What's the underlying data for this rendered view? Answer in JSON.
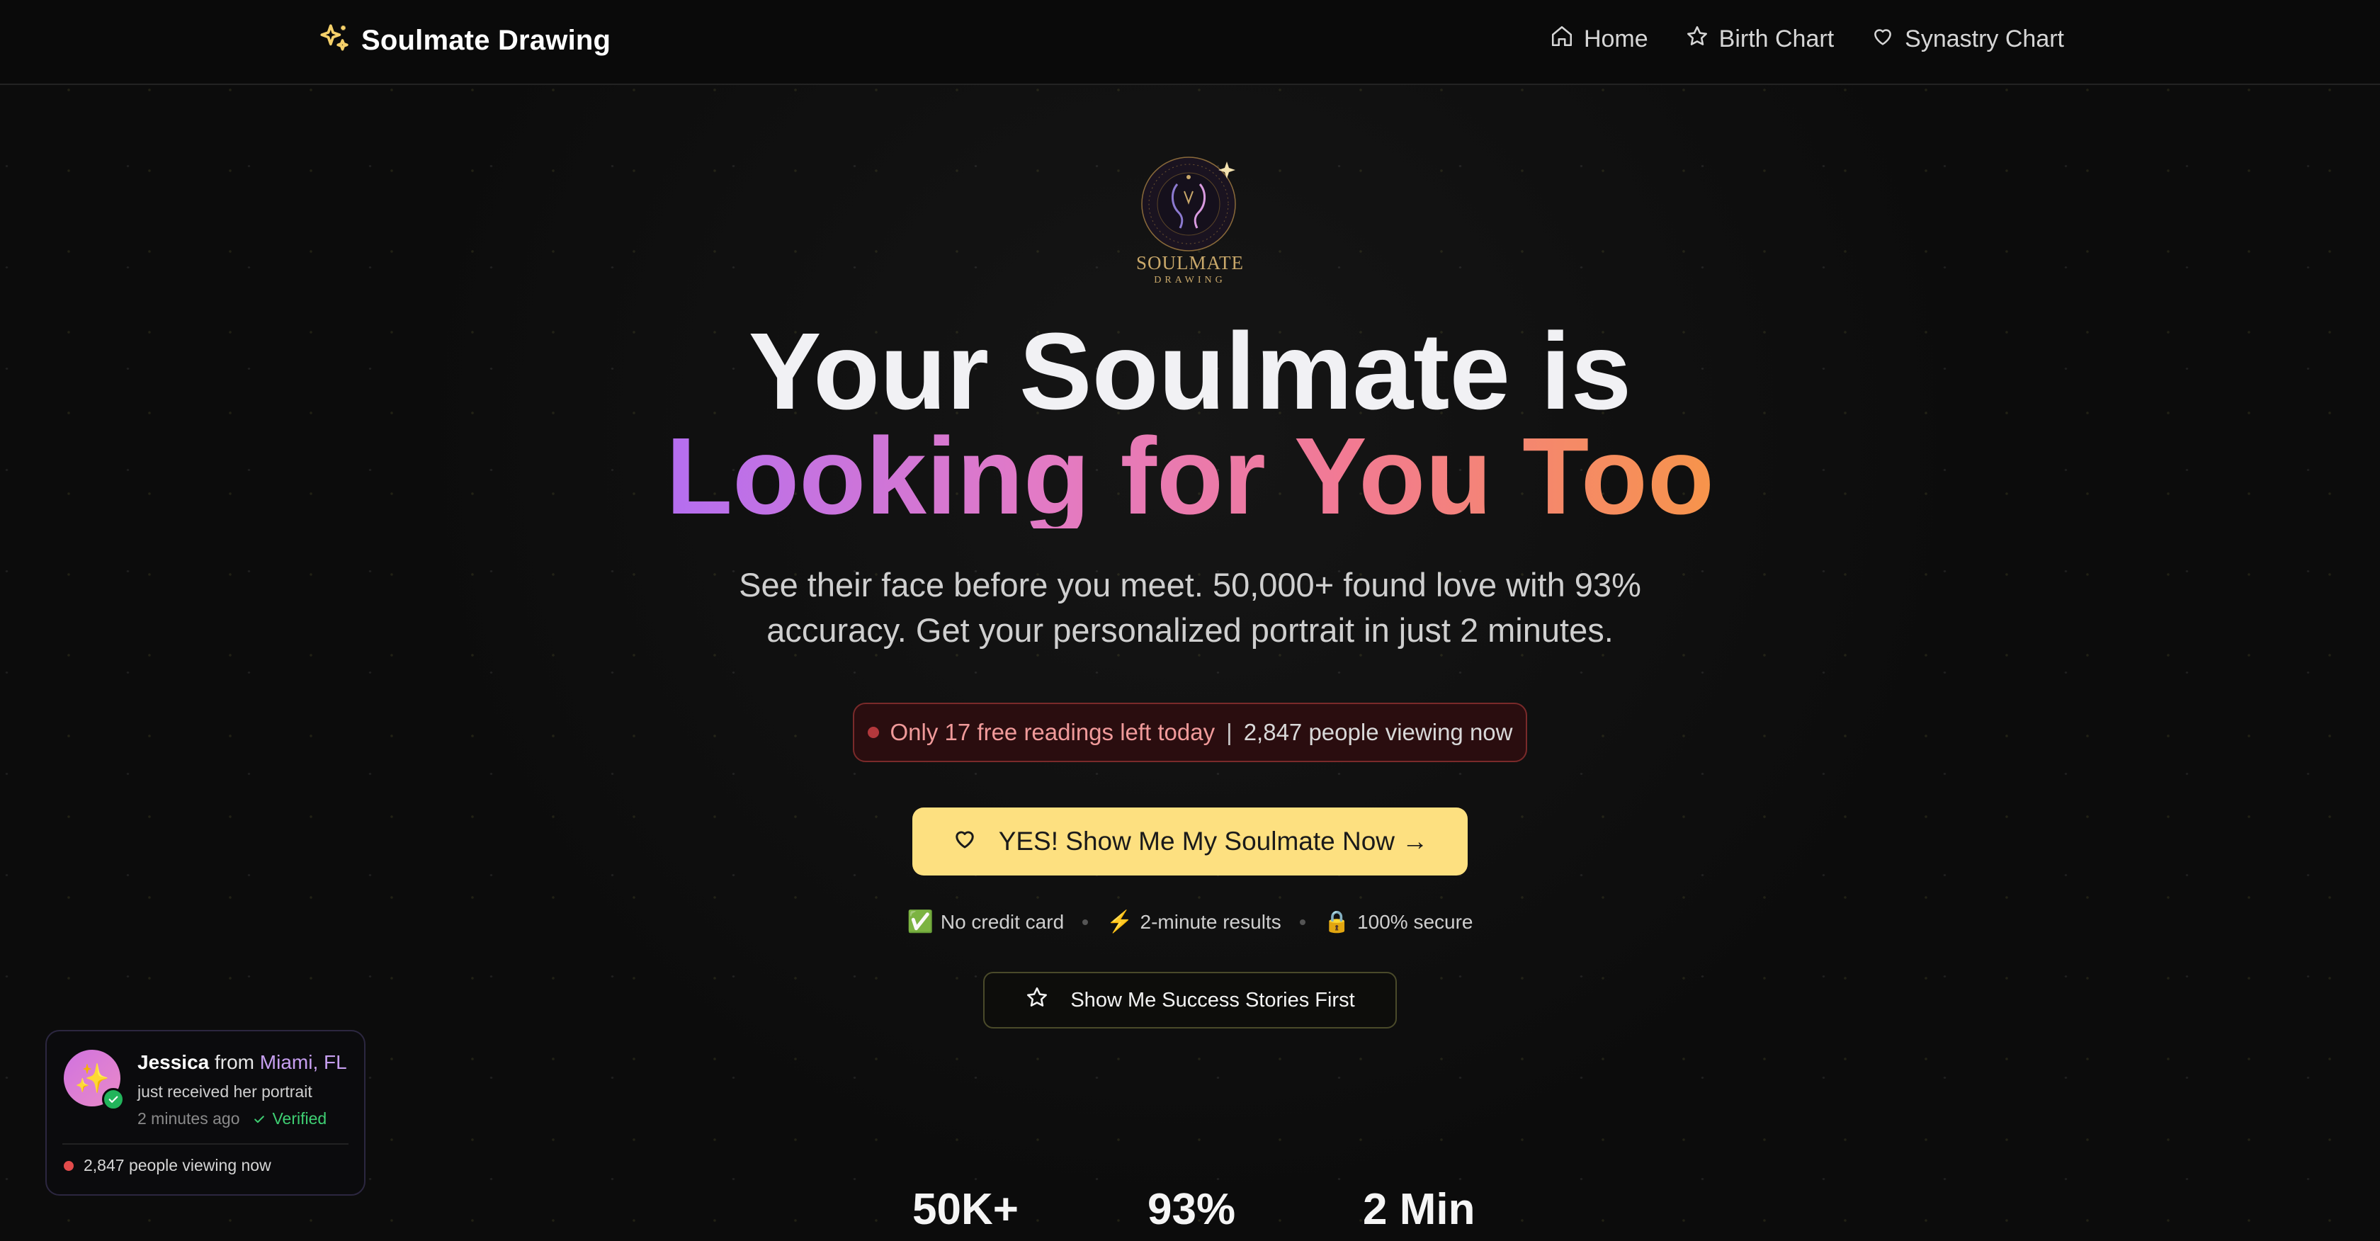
{
  "header": {
    "brand": "Soulmate Drawing",
    "nav": [
      {
        "label": "Home",
        "icon": "home-icon"
      },
      {
        "label": "Birth Chart",
        "icon": "star-icon"
      },
      {
        "label": "Synastry Chart",
        "icon": "heart-icon"
      }
    ]
  },
  "emblem": {
    "title": "SOULMATE",
    "subtitle": "DRAWING"
  },
  "hero": {
    "title_line1": "Your Soulmate is",
    "title_line2": "Looking for You Too",
    "subtitle": "See their face before you meet. 50,000+ found love with 93% accuracy. Get your personalized portrait in just 2 minutes."
  },
  "urgency": {
    "left": "Only 17 free readings left today",
    "separator": "|",
    "right": "2,847 people viewing now"
  },
  "cta": {
    "label": "YES! Show Me My Soulmate Now →",
    "icon": "heart-icon"
  },
  "badges": [
    {
      "icon": "✅",
      "label": "No credit card"
    },
    {
      "icon": "⚡",
      "label": "2-minute results"
    },
    {
      "icon": "🔒",
      "label": "100% secure"
    }
  ],
  "secondary_cta": {
    "label": "Show Me Success Stories First",
    "icon": "star-icon"
  },
  "toast": {
    "avatar_icon": "✨",
    "name": "Jessica",
    "from": "from",
    "location": "Miami, FL",
    "message": "just received her portrait",
    "time": "2 minutes ago",
    "verified": "Verified",
    "viewers": "2,847 people viewing now"
  },
  "stats": [
    {
      "value": "50K+"
    },
    {
      "value": "93%"
    },
    {
      "value": "2 Min"
    }
  ],
  "colors": {
    "background": "#0c0c0c",
    "cta": "#fde080",
    "accent_purple": "#b46ef0",
    "accent_orange": "#f7944a",
    "urgency_bg": "#2a0d0f",
    "verified_green": "#3fcf73"
  }
}
